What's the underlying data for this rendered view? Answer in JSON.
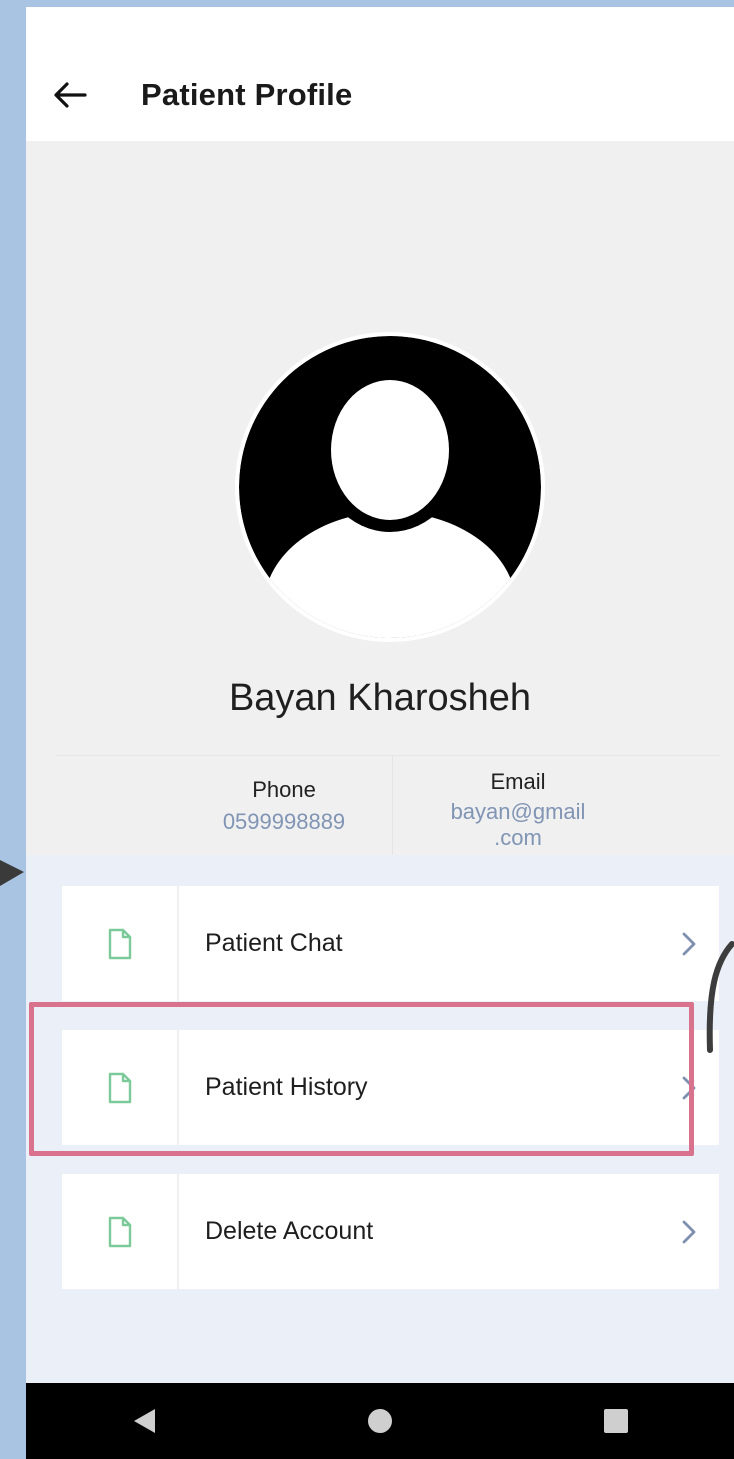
{
  "header": {
    "title": "Patient Profile"
  },
  "profile": {
    "name": "Bayan Kharosheh",
    "phone_label": "Phone",
    "phone_value": "0599998889",
    "email_label": "Email",
    "email_value_line1": "bayan@gmail",
    "email_value_line2": ".com"
  },
  "menu": {
    "items": [
      {
        "label": "Patient Chat",
        "icon": "document-icon"
      },
      {
        "label": "Patient History",
        "icon": "document-icon",
        "highlighted": true
      },
      {
        "label": "Delete Account",
        "icon": "document-icon"
      }
    ]
  },
  "colors": {
    "icon_green": "#7cc99a",
    "chevron": "#7f8fb0",
    "highlight": "#d9728c",
    "menu_bg": "#ebeff7",
    "frame_bg": "#a9c3e2"
  }
}
